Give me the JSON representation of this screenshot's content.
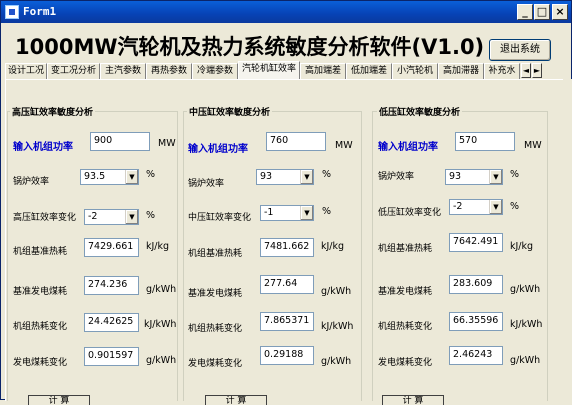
{
  "window": {
    "title": "Form1",
    "minimize": "_",
    "maximize": "□",
    "close": "×"
  },
  "heading": "1000MW汽轮机及热力系统敏度分析软件(V1.0)",
  "exit_label": "退出系统",
  "tabs": [
    "设计工况",
    "变工况分析",
    "主汽参数",
    "再热参数",
    "冷端参数",
    "汽轮机缸效率",
    "高加端差",
    "低加端差",
    "小汽轮机",
    "高加滞器",
    "补充水"
  ],
  "tab_scroll": {
    "left": "◄",
    "right": "►"
  },
  "active_tab_index": 5,
  "groups": [
    {
      "title": "高压缸效率敏度分析",
      "power_label": "输入机组功率",
      "power": "900",
      "power_unit": "MW",
      "boiler_label": "锅炉效率",
      "boiler": "93.5",
      "boiler_unit": "%",
      "change_label": "高压缸效率变化",
      "change": "-2",
      "change_unit": "%",
      "heat_label": "机组基准热耗",
      "heat": "7429.661",
      "heat_unit": "kJ/kg",
      "coal_label": "基准发电煤耗",
      "coal": "274.236",
      "coal_unit": "g/kWh",
      "heatchg_label": "机组热耗变化",
      "heatchg": "24.42625",
      "heatchg_unit": "kJ/kWh",
      "coalchg_label": "发电煤耗变化",
      "coalchg": "0.901597",
      "coalchg_unit": "g/kWh",
      "calc_label": "计  算"
    },
    {
      "title": "中压缸效率敏度分析",
      "power_label": "输入机组功率",
      "power": "760",
      "power_unit": "MW",
      "boiler_label": "锅炉效率",
      "boiler": "93",
      "boiler_unit": "%",
      "change_label": "中压缸效率变化",
      "change": "-1",
      "change_unit": "%",
      "heat_label": "机组基准热耗",
      "heat": "7481.662",
      "heat_unit": "kJ/kg",
      "coal_label": "基准发电煤耗",
      "coal": "277.64",
      "coal_unit": "g/kWh",
      "heatchg_label": "机组热耗变化",
      "heatchg": "7.865371",
      "heatchg_unit": "kJ/kWh",
      "coalchg_label": "发电煤耗变化",
      "coalchg": "0.29188",
      "coalchg_unit": "g/kWh",
      "calc_label": "计  算"
    },
    {
      "title": "低压缸效率敏度分析",
      "power_label": "输入机组功率",
      "power": "570",
      "power_unit": "MW",
      "boiler_label": "锅炉效率",
      "boiler": "93",
      "boiler_unit": "%",
      "change_label": "低压缸效率变化",
      "change": "-2",
      "change_unit": "%",
      "heat_label": "机组基准热耗",
      "heat": "7642.491",
      "heat_unit": "kJ/kg",
      "coal_label": "基准发电煤耗",
      "coal": "283.609",
      "coal_unit": "g/kWh",
      "heatchg_label": "机组热耗变化",
      "heatchg": "66.35596",
      "heatchg_unit": "kJ/kWh",
      "coalchg_label": "发电煤耗变化",
      "coalchg": "2.46243",
      "coalchg_unit": "g/kWh",
      "calc_label": "计  算"
    }
  ]
}
